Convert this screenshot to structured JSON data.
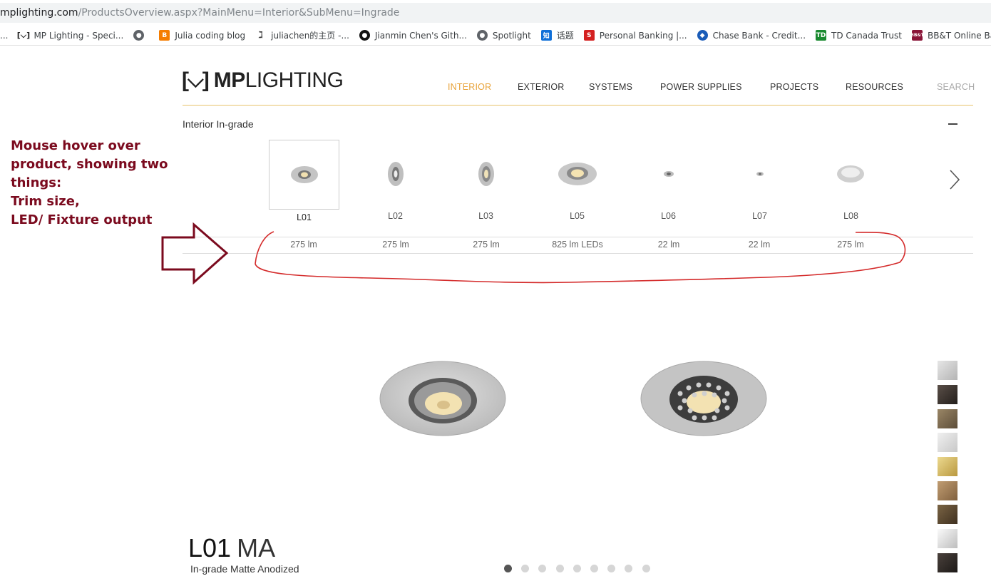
{
  "browser": {
    "url_host": "mplighting.com",
    "url_path": "/ProductsOverview.aspx?MainMenu=Interior&SubMenu=Ingrade",
    "bookmarks": [
      {
        "label": "...",
        "icon": "apps-icon"
      },
      {
        "label": "MP Lighting - Speci...",
        "icon": "mp-lighting-icon"
      },
      {
        "label": "",
        "icon": "globe-icon"
      },
      {
        "label": "Julia coding blog",
        "icon": "blogger-icon"
      },
      {
        "label": "juliachen的主页 -...",
        "icon": "zhihu-user-icon"
      },
      {
        "label": "Jianmin Chen's Gith...",
        "icon": "github-icon"
      },
      {
        "label": "Spotlight",
        "icon": "globe-icon"
      },
      {
        "label": "话题",
        "icon": "zhihu-icon"
      },
      {
        "label": "Personal Banking |...",
        "icon": "bank-icon"
      },
      {
        "label": "Chase Bank - Credit...",
        "icon": "chase-icon"
      },
      {
        "label": "TD Canada Trust",
        "icon": "td-icon"
      },
      {
        "label": "BB&T Online Banki...",
        "icon": "bbt-icon"
      }
    ]
  },
  "site": {
    "logo_mark": "[⌵]",
    "logo_mp": "MP",
    "logo_lighting": "LIGHTING",
    "nav": [
      "INTERIOR",
      "EXTERIOR",
      "SYSTEMS",
      "POWER SUPPLIES",
      "PROJECTS",
      "RESOURCES"
    ],
    "nav_active": "INTERIOR",
    "search": "SEARCH",
    "accent_color": "#e8a33a"
  },
  "section": {
    "title": "Interior In-grade",
    "products": [
      {
        "name": "L01",
        "output": "275 lm",
        "selected": true
      },
      {
        "name": "L02",
        "output": "275 lm"
      },
      {
        "name": "L03",
        "output": "275 lm"
      },
      {
        "name": "L05",
        "output": "825 lm LEDs"
      },
      {
        "name": "L06",
        "output": "22 lm"
      },
      {
        "name": "L07",
        "output": "22 lm"
      },
      {
        "name": "L08",
        "output": "275 lm"
      }
    ]
  },
  "annotation": {
    "lines": [
      "Mouse hover over",
      "product, showing two",
      "things:",
      "Trim size,",
      "LED/ Fixture output"
    ],
    "color": "#7b0a1e"
  },
  "hero": {
    "model": "L01",
    "finish": "MA",
    "subtitle": "In-grade Matte Anodized",
    "slides": 9,
    "active_slide": 1,
    "swatches": [
      "#c8c8c8",
      "#3a332e",
      "#7d6a4f",
      "#dcdcdc",
      "#d9bf6c",
      "#a8865e",
      "#5e4b33",
      "#e4e4e4",
      "#2f2a27"
    ]
  }
}
